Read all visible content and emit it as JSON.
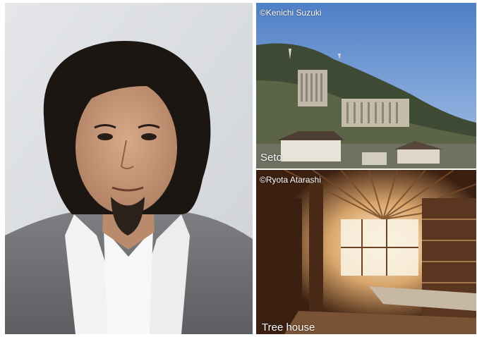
{
  "portrait": {
    "description_icon": "portrait-photo"
  },
  "photos": {
    "seto": {
      "credit": "©Kenichi Suzuki",
      "caption": "Seto"
    },
    "tree_house": {
      "credit": "©Ryota Atarashi",
      "caption": "Tree house"
    }
  }
}
